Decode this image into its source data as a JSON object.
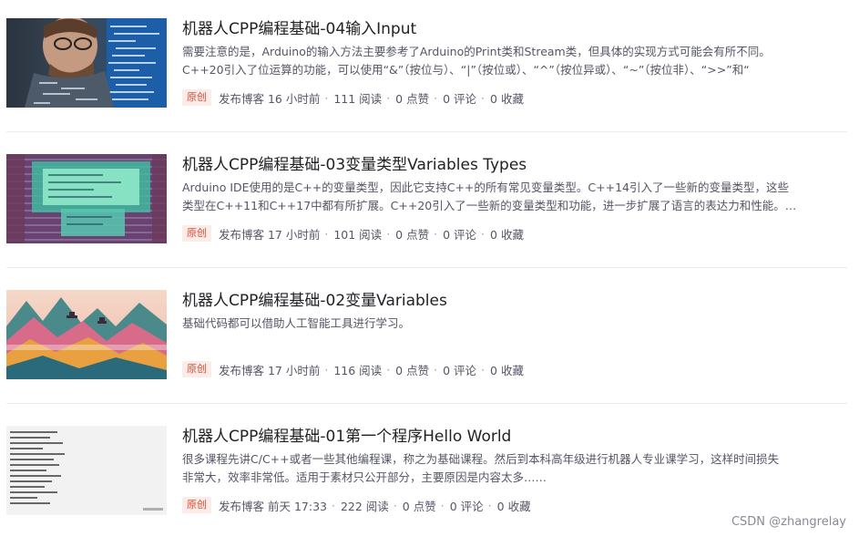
{
  "articles": [
    {
      "title": "机器人CPP编程基础-04输入Input",
      "desc": [
        "需要注意的是，Arduino的输入方法主要参考了Arduino的Print类和Stream类，但具体的实现方式可能会有所不同。",
        "C++20引入了位运算的功能，可以使用“&”（按位与）、“|”（按位或）、“^”（按位异或）、“~”（按位非）、“>>”和“"
      ],
      "badge": "原创",
      "published": "发布博客 16 小时前",
      "reads": "111 阅读",
      "likes": "0 点赞",
      "comments": "0 评论",
      "favorites": "0 收藏"
    },
    {
      "title": "机器人CPP编程基础-03变量类型Variables Types",
      "desc": [
        "Arduino IDE使用的是C++的变量类型，因此它支持C++的所有常见变量类型。C++14引入了一些新的变量类型，这些",
        "类型在C++11和C++17中都有所扩展。C++20引入了一些新的变量类型和功能，进一步扩展了语言的表达力和性能。…"
      ],
      "badge": "原创",
      "published": "发布博客 17 小时前",
      "reads": "101 阅读",
      "likes": "0 点赞",
      "comments": "0 评论",
      "favorites": "0 收藏"
    },
    {
      "title": "机器人CPP编程基础-02变量Variables",
      "desc": [
        "基础代码都可以借助人工智能工具进行学习。"
      ],
      "badge": "原创",
      "published": "发布博客 17 小时前",
      "reads": "116 阅读",
      "likes": "0 点赞",
      "comments": "0 评论",
      "favorites": "0 收藏"
    },
    {
      "title": "机器人CPP编程基础-01第一个程序Hello World",
      "desc": [
        "很多课程先讲C/C++或者一些其他编程课，称之为基础课程。然后到本科高年级进行机器人专业课学习，这样时间损失",
        "非常大，效率非常低。适用于素材只公开部分，主要原因是内容太多……"
      ],
      "badge": "原创",
      "published": "发布博客 前天 17:33",
      "reads": "222 阅读",
      "likes": "0 点赞",
      "comments": "0 评论",
      "favorites": "0 收藏"
    }
  ],
  "watermark": "CSDN @zhangrelay",
  "colors": {
    "badge_bg": "#fcece8",
    "badge_text": "#d94d35",
    "title": "#222226",
    "meta": "#555666"
  }
}
